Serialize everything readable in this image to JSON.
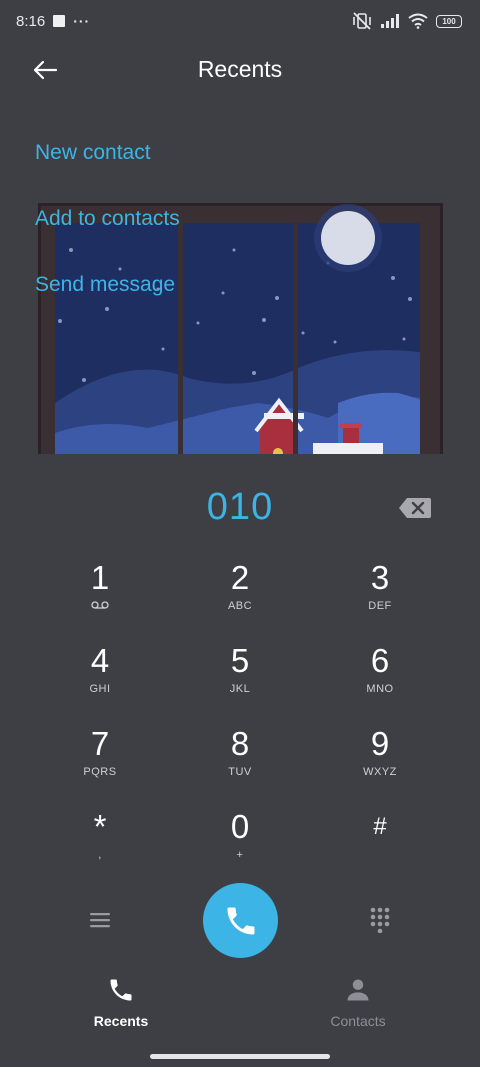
{
  "status_bar": {
    "time": "8:16",
    "dots": "···",
    "battery": "100"
  },
  "header": {
    "title": "Recents",
    "back_icon": "arrow-left-icon"
  },
  "menu": {
    "items": [
      {
        "label": "New contact"
      },
      {
        "label": "Add to contacts"
      },
      {
        "label": "Send message"
      }
    ]
  },
  "dialer": {
    "number": "010",
    "keys": [
      {
        "digit": "1",
        "letters": ""
      },
      {
        "digit": "2",
        "letters": "ABC"
      },
      {
        "digit": "3",
        "letters": "DEF"
      },
      {
        "digit": "4",
        "letters": "GHI"
      },
      {
        "digit": "5",
        "letters": "JKL"
      },
      {
        "digit": "6",
        "letters": "MNO"
      },
      {
        "digit": "7",
        "letters": "PQRS"
      },
      {
        "digit": "8",
        "letters": "TUV"
      },
      {
        "digit": "9",
        "letters": "WXYZ"
      },
      {
        "digit": "*",
        "letters": ","
      },
      {
        "digit": "0",
        "letters": "+"
      },
      {
        "digit": "#",
        "letters": ""
      }
    ]
  },
  "bottom_nav": {
    "recents": "Recents",
    "contacts": "Contacts"
  },
  "colors": {
    "accent": "#3cb4e5",
    "background": "#3e3e45"
  }
}
